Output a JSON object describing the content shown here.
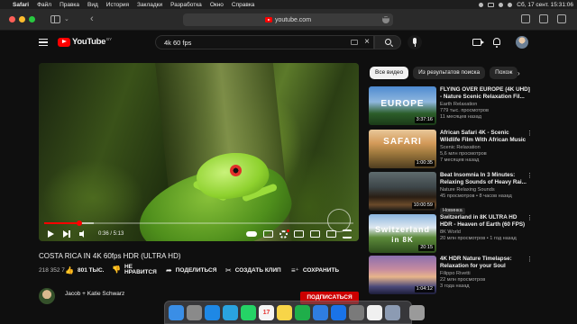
{
  "menubar": {
    "app_name": "Safari",
    "items": [
      "Файл",
      "Правка",
      "Вид",
      "История",
      "Закладки",
      "Разработка",
      "Окно",
      "Справка"
    ],
    "clock": "Сб, 17 сент.  15:31:06"
  },
  "browser": {
    "address": "youtube.com"
  },
  "youtube": {
    "logo_text": "YouTube",
    "region": "BY",
    "search_value": "4k 60 fps"
  },
  "player": {
    "time": "0:36 / 5:13",
    "progress_fraction": 0.115,
    "buffered_fraction": 0.16
  },
  "video": {
    "title": "COSTA RICA IN 4K 60fps HDR (ULTRA HD)",
    "subs_count": "218 352 7",
    "like_count": "801 ТЫС.",
    "dislike_label_1": "НЕ",
    "dislike_label_2": "НРАВИТСЯ",
    "share_label": "ПОДЕЛИТЬСЯ",
    "clip_label": "СОЗДАТЬ КЛИП",
    "save_label": "СОХРАНИТЬ",
    "channel_name": "Jacob + Katie Schwarz",
    "subscribe_label": "ПОДПИСАТЬСЯ"
  },
  "chips": [
    "Все видео",
    "Из результатов поиска",
    "Похож"
  ],
  "recommendations": [
    {
      "title": "FLYING OVER EUROPE (4K UHD) - Nature Scenic Relaxation Fil...",
      "channel": "Earth Relaxation",
      "views": "779 тыс. просмотров",
      "age": "11 месяцев назад",
      "duration": "3:37:16",
      "overlay": "EUROPE"
    },
    {
      "title": "African Safari 4K - Scenic Wildlife Film With African Music",
      "channel": "Scenic Relaxation",
      "views": "5,6 млн просмотров",
      "age": "7 месяцев назад",
      "duration": "1:00:35",
      "overlay": "SAFARI"
    },
    {
      "title": "Beat Insomnia In 3 Minutes: Relaxing Sounds of Heavy Rai...",
      "channel": "Nature Relaxing Sounds",
      "views": "45 просмотров",
      "age": "8 часов назад",
      "duration": "10:00:59",
      "badge": "Новинка",
      "overlay": ""
    },
    {
      "title": "Switzerland in 8K ULTRA HD HDR - Heaven of Earth (60 FPS)",
      "channel": "8K World",
      "views": "20 млн просмотров",
      "age": "1 год назад",
      "duration": "20:15",
      "overlay": "Switzerland",
      "overlay2": "in 8K"
    },
    {
      "title": "4K HDR Nature Timelapse: Relaxation for your Soul",
      "channel": "Filippo Rivetti",
      "views": "22 млн просмотров",
      "age": "3 года назад",
      "duration": "1:04:12",
      "overlay": ""
    }
  ],
  "dock": {
    "apps": [
      "finder",
      "launchpad",
      "safari",
      "telegram",
      "whatsapp",
      "calendar",
      "notes",
      "numbers",
      "keynote",
      "app-store",
      "settings",
      "photos",
      "preview",
      "trash"
    ],
    "calendar_day": "17",
    "colors": {
      "finder": "#3a8ee6",
      "launchpad": "#8a8a8a",
      "safari": "#1e88e5",
      "telegram": "#2aa3df",
      "whatsapp": "#25d366",
      "calendar": "#f5f5f5",
      "notes": "#f8d548",
      "numbers": "#1fae4a",
      "keynote": "#2f7de1",
      "app-store": "#1a73e8",
      "settings": "#7a7a7a",
      "photos": "#f0f0f0",
      "preview": "#8c9bb3",
      "trash": "#9a9a9a"
    }
  }
}
